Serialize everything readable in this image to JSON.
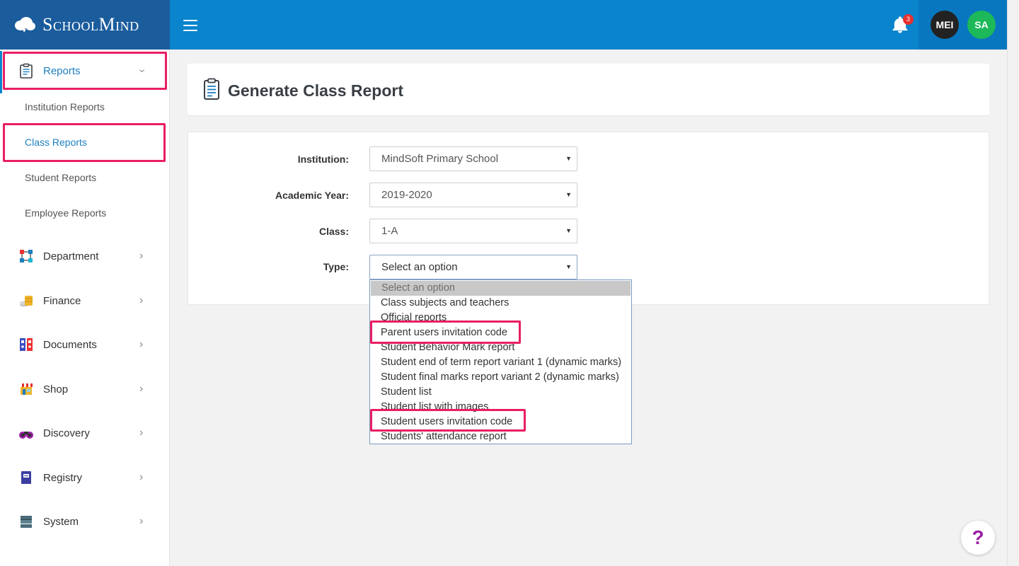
{
  "brand": {
    "name": "SchoolMind"
  },
  "header": {
    "notifications_count": "3",
    "avatars": [
      "MEI",
      "SA"
    ]
  },
  "sidebar": {
    "reports_label": "Reports",
    "sub_items": [
      "Institution Reports",
      "Class Reports",
      "Student Reports",
      "Employee Reports"
    ],
    "items": [
      "Department",
      "Finance",
      "Documents",
      "Shop",
      "Discovery",
      "Registry",
      "System"
    ]
  },
  "page": {
    "title": "Generate Class Report"
  },
  "form": {
    "institution": {
      "label": "Institution:",
      "value": "MindSoft Primary School"
    },
    "academic_year": {
      "label": "Academic Year:",
      "value": "2019-2020"
    },
    "class": {
      "label": "Class:",
      "value": "1-A"
    },
    "type": {
      "label": "Type:",
      "value": "Select an option"
    }
  },
  "type_options": [
    "Select an option",
    "Class subjects and teachers",
    "Official reports",
    "Parent users invitation code",
    "Student Behavior Mark report",
    "Student end of term report variant 1 (dynamic marks)",
    "Student final marks report variant 2 (dynamic marks)",
    "Student list",
    "Student list with images",
    "Student users invitation code",
    "Students' attendance report"
  ],
  "help": {
    "label": "?"
  },
  "colors": {
    "header": "#0a84cc",
    "logo_bg": "#1a5c9c",
    "active": "#1c7fc0",
    "highlight": "#e91e63"
  }
}
